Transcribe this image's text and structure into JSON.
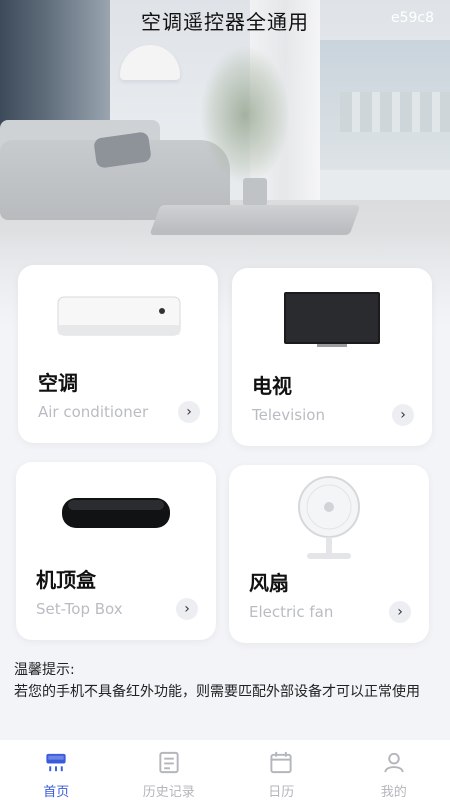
{
  "header": {
    "title": "空调遥控器全通用",
    "device_id": "e59c8"
  },
  "cards": [
    {
      "name": "空调",
      "subtitle": "Air conditioner",
      "icon": "air-conditioner"
    },
    {
      "name": "电视",
      "subtitle": "Television",
      "icon": "television"
    },
    {
      "name": "机顶盒",
      "subtitle": "Set-Top Box",
      "icon": "set-top-box"
    },
    {
      "name": "风扇",
      "subtitle": "Electric fan",
      "icon": "electric-fan"
    }
  ],
  "tips": {
    "title": "温馨提示:",
    "body": "若您的手机不具备红外功能，则需要匹配外部设备才可以正常使用"
  },
  "tabbar": {
    "items": [
      {
        "label": "首页",
        "icon": "home-remote-icon",
        "active": true
      },
      {
        "label": "历史记录",
        "icon": "history-icon",
        "active": false
      },
      {
        "label": "日历",
        "icon": "calendar-icon",
        "active": false
      },
      {
        "label": "我的",
        "icon": "user-icon",
        "active": false
      }
    ],
    "active_color": "#3b5bdb",
    "inactive_color": "#b3b6bb"
  }
}
